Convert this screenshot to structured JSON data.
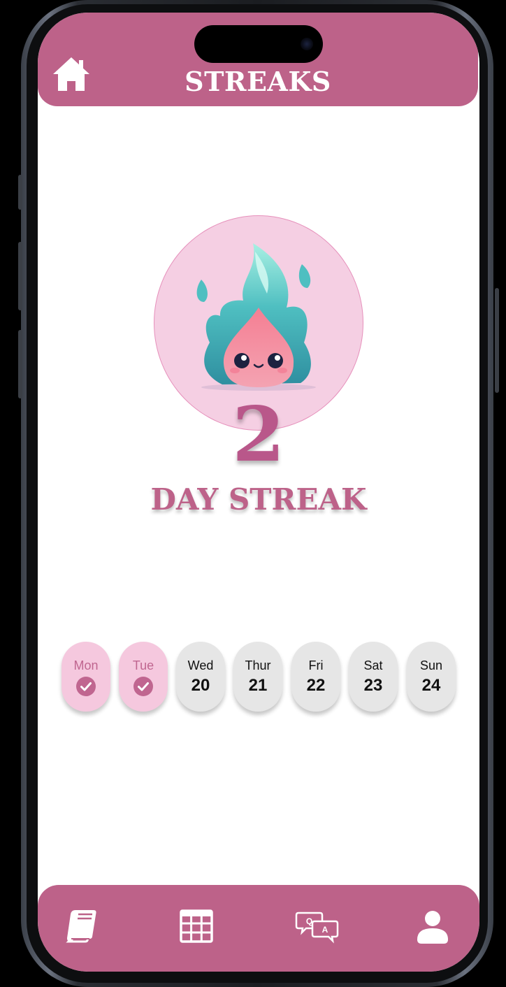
{
  "header": {
    "title": "STREAKS",
    "home_icon": "home-icon"
  },
  "streak": {
    "count": "2",
    "label": "DAY STREAK",
    "mascot": "flame-mascot-icon"
  },
  "week": [
    {
      "day": "Mon",
      "date": "",
      "completed": true
    },
    {
      "day": "Tue",
      "date": "",
      "completed": true
    },
    {
      "day": "Wed",
      "date": "20",
      "completed": false
    },
    {
      "day": "Thur",
      "date": "21",
      "completed": false
    },
    {
      "day": "Fri",
      "date": "22",
      "completed": false
    },
    {
      "day": "Sat",
      "date": "23",
      "completed": false
    },
    {
      "day": "Sun",
      "date": "24",
      "completed": false
    }
  ],
  "bottom_nav": {
    "items": [
      "book-icon",
      "calendar-grid-icon",
      "qa-chat-icon",
      "profile-icon"
    ]
  },
  "colors": {
    "accent": "#bd6289",
    "completed_pill": "#f5c8de",
    "pending_pill": "#e6e6e6",
    "mascot_bg": "#f5cfe3"
  }
}
